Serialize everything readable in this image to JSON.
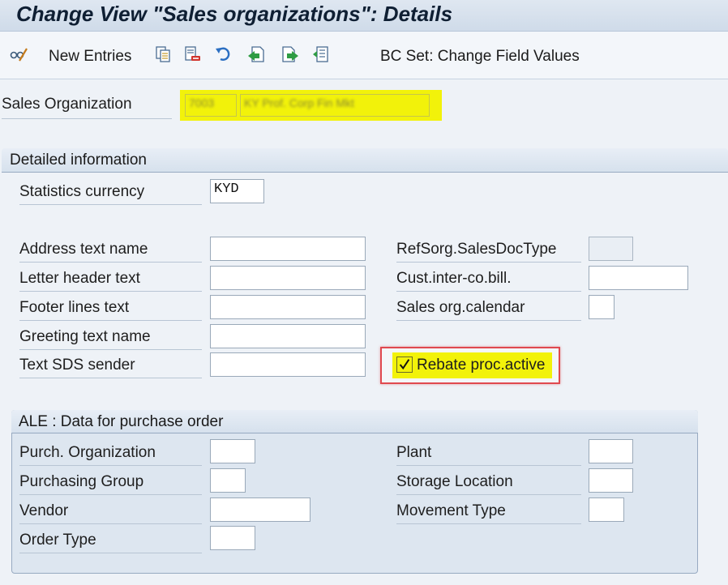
{
  "header": {
    "title": "Change View \"Sales organizations\": Details"
  },
  "toolbar": {
    "new_entries_label": "New Entries",
    "bc_set_label": "BC Set: Change Field Values",
    "icons": [
      "display-change-icon",
      "copy-icon",
      "delete-icon",
      "undo-icon",
      "previous-entry-icon",
      "next-entry-icon",
      "variable-list-icon"
    ]
  },
  "sales_org": {
    "label": "Sales Organization",
    "code_blurred": "7003",
    "name_blurred": "KY Prof. Corp Fin Mkt"
  },
  "detailed": {
    "header": "Detailed information",
    "statistics_currency_label": "Statistics currency",
    "statistics_currency_value": "KYD",
    "left_fields": [
      {
        "label": "Address text name",
        "value": ""
      },
      {
        "label": "Letter header text",
        "value": ""
      },
      {
        "label": "Footer lines text",
        "value": ""
      },
      {
        "label": "Greeting text name",
        "value": ""
      },
      {
        "label": "Text SDS sender",
        "value": ""
      }
    ],
    "right_fields": [
      {
        "label": "RefSorg.SalesDocType",
        "value": ""
      },
      {
        "label": "Cust.inter-co.bill.",
        "value": ""
      },
      {
        "label": "Sales org.calendar",
        "value": ""
      }
    ],
    "rebate_checkbox": {
      "label": "Rebate proc.active",
      "checked": true
    }
  },
  "ale": {
    "header": "ALE : Data for purchase order",
    "left_fields": [
      {
        "label": "Purch. Organization",
        "value": ""
      },
      {
        "label": "Purchasing Group",
        "value": ""
      },
      {
        "label": "Vendor",
        "value": ""
      },
      {
        "label": "Order Type",
        "value": ""
      }
    ],
    "right_fields": [
      {
        "label": "Plant",
        "value": ""
      },
      {
        "label": "Storage Location",
        "value": ""
      },
      {
        "label": "Movement Type",
        "value": ""
      }
    ]
  },
  "colors": {
    "highlight_yellow": "#f2f20a",
    "red_outline": "#e0494f",
    "checkbox_check": "#f2f20a"
  }
}
